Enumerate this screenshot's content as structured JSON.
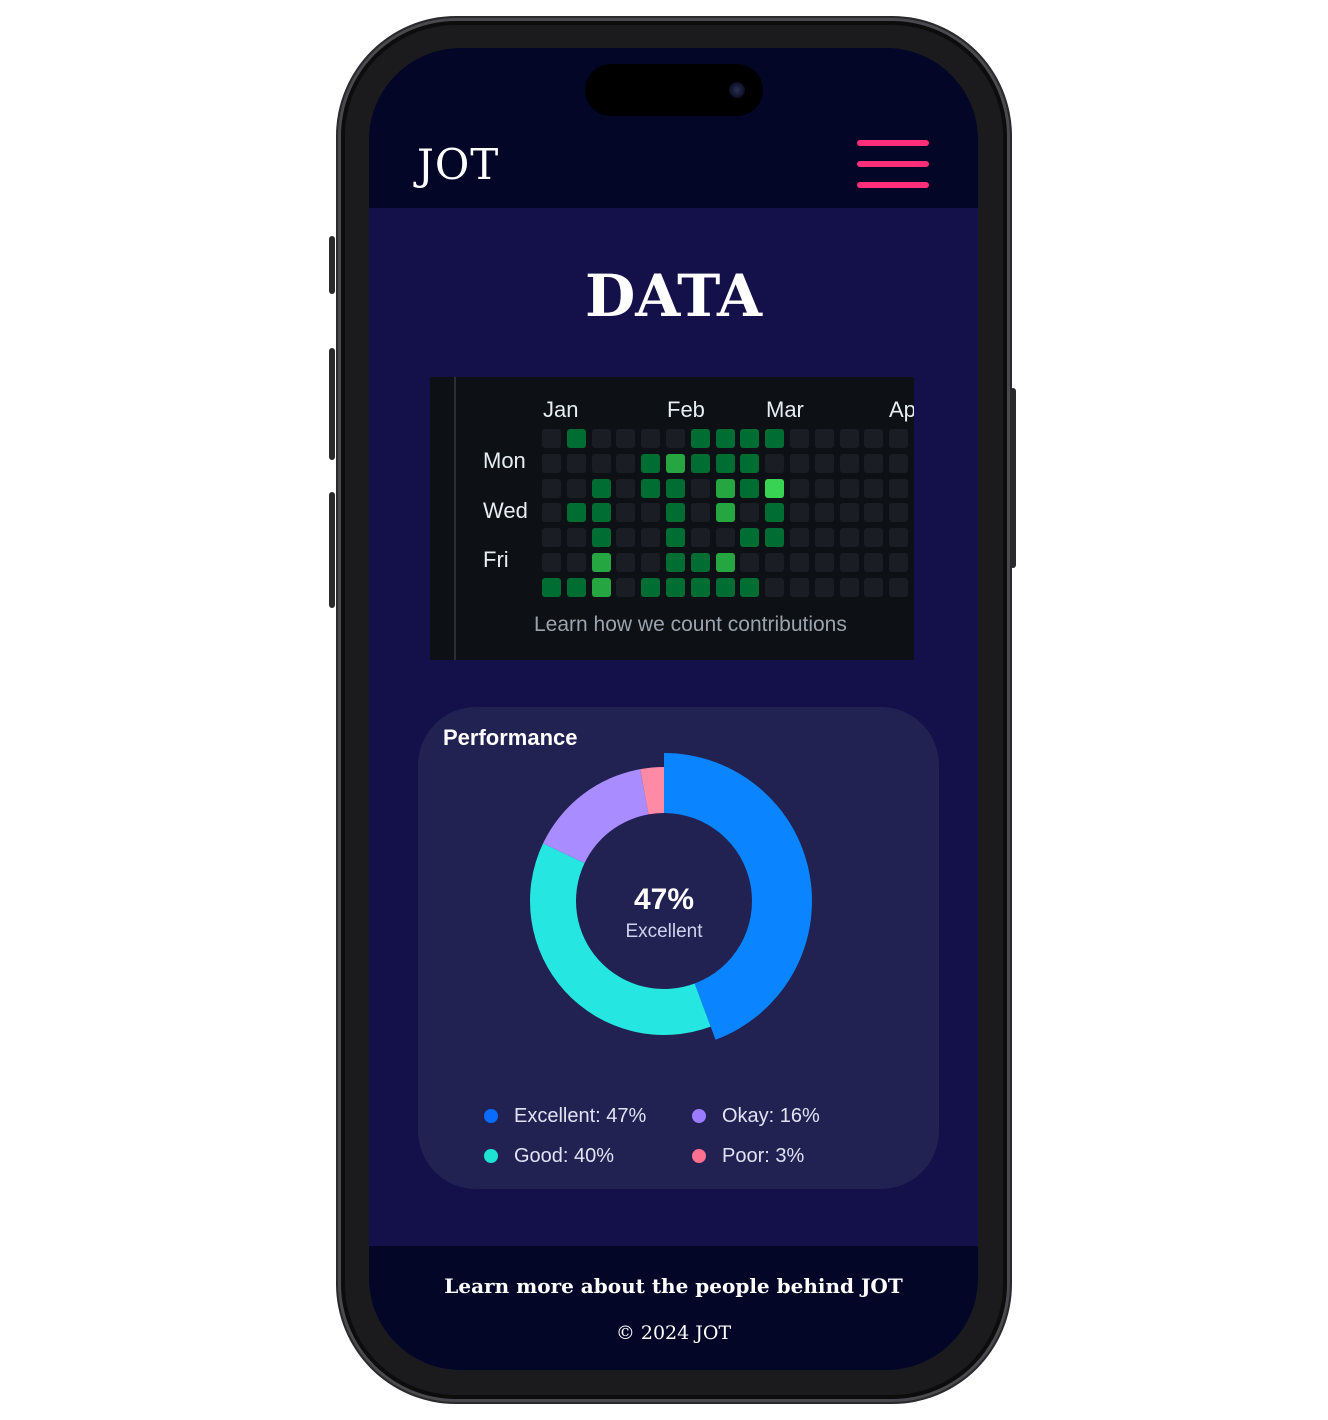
{
  "header": {
    "logo": "JOT",
    "menu_icon": "hamburger-menu-icon",
    "menu_color": "#ff2d7a"
  },
  "page": {
    "title": "DATA"
  },
  "contributions": {
    "months": [
      "Jan",
      "Feb",
      "Mar",
      "Ap"
    ],
    "days": [
      "Mon",
      "Wed",
      "Fri"
    ],
    "footer_link": "Learn how we count contributions",
    "levels_colors": [
      "#1a1e24",
      "#0e4429",
      "#006d32",
      "#26a641",
      "#39d353"
    ],
    "grid": [
      [
        0,
        2,
        0,
        0,
        0,
        0,
        2,
        2,
        2,
        2,
        0,
        0,
        0,
        0,
        0
      ],
      [
        0,
        0,
        0,
        0,
        2,
        3,
        2,
        2,
        2,
        0,
        0,
        0,
        0,
        0,
        0
      ],
      [
        0,
        0,
        2,
        0,
        2,
        2,
        0,
        3,
        2,
        4,
        0,
        0,
        0,
        0,
        0
      ],
      [
        0,
        2,
        2,
        0,
        0,
        2,
        0,
        3,
        0,
        2,
        0,
        0,
        0,
        0,
        0
      ],
      [
        0,
        0,
        2,
        0,
        0,
        2,
        0,
        0,
        2,
        2,
        0,
        0,
        0,
        0,
        0
      ],
      [
        0,
        0,
        3,
        0,
        0,
        2,
        2,
        3,
        0,
        0,
        0,
        0,
        0,
        0,
        0
      ],
      [
        2,
        2,
        3,
        0,
        2,
        2,
        2,
        2,
        2,
        0,
        0,
        0,
        0,
        0,
        0
      ]
    ]
  },
  "performance": {
    "title": "Performance",
    "center_value": "47%",
    "center_label": "Excellent",
    "legend": [
      {
        "label": "Excellent: 47%",
        "color": "#0a6cff"
      },
      {
        "label": "Okay: 16%",
        "color": "#9b7bff"
      },
      {
        "label": "Good: 40%",
        "color": "#1ee3d4"
      },
      {
        "label": "Poor: 3%",
        "color": "#ff6f8f"
      }
    ]
  },
  "chart_data": {
    "type": "pie",
    "title": "Performance",
    "categories": [
      "Excellent",
      "Good",
      "Okay",
      "Poor"
    ],
    "values": [
      47,
      40,
      16,
      3
    ],
    "colors": [
      "#0a84ff",
      "#25e6e0",
      "#a98cff",
      "#ff8aa6"
    ]
  },
  "footer": {
    "link": "Learn more about the people behind JOT",
    "copyright": "© 2024 JOT"
  }
}
